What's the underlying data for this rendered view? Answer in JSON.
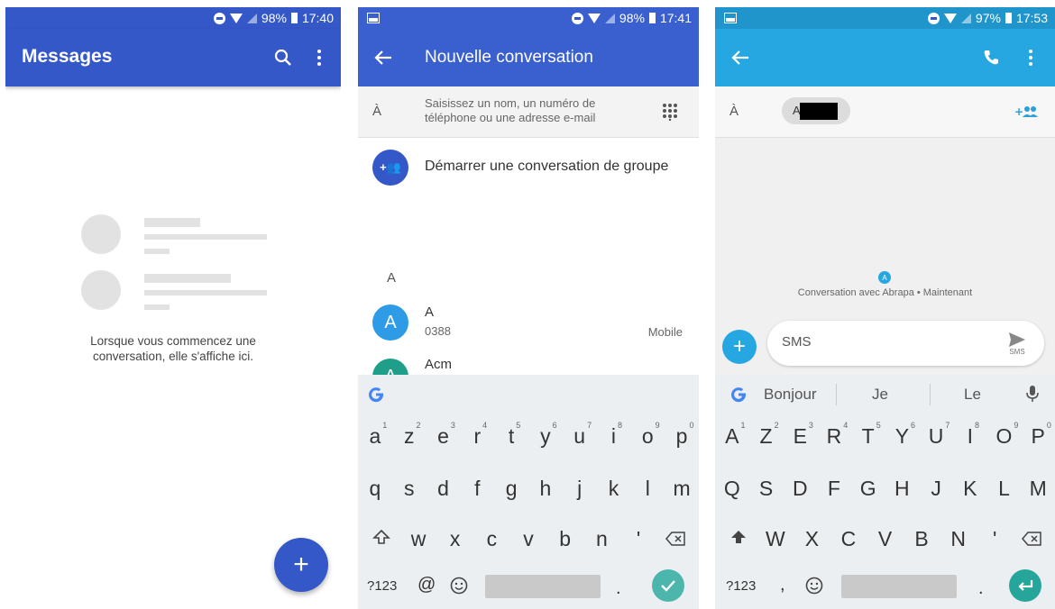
{
  "screen1": {
    "status": {
      "battery": "98%",
      "time": "17:40"
    },
    "title": "Messages",
    "empty_text_line1": "Lorsque vous commencez une",
    "empty_text_line2": "conversation, elle s'affiche ici.",
    "fab_icon": "+",
    "colors": {
      "appbar": "#3558C8",
      "fab": "#3558C8"
    }
  },
  "screen2": {
    "status": {
      "battery": "98%",
      "time": "17:41"
    },
    "title": "Nouvelle conversation",
    "to_label": "À",
    "to_placeholder_line1": "Saisissez un nom, un numéro de",
    "to_placeholder_line2": "téléphone ou une adresse e-mail",
    "group_label": "Démarrer une conversation de groupe",
    "group_icon": "+👥",
    "section_letter": "A",
    "contacts": [
      {
        "initial": "A",
        "name": "A",
        "number": "0388",
        "type": "Mobile",
        "color": "#2e9be6"
      },
      {
        "initial": "A",
        "name": "Acm",
        "number": "",
        "type": "",
        "color": "#1f9e89"
      }
    ],
    "keyboard": {
      "row1": [
        "a",
        "z",
        "e",
        "r",
        "t",
        "y",
        "u",
        "i",
        "o",
        "p"
      ],
      "row1_sup": [
        "1",
        "2",
        "3",
        "4",
        "5",
        "6",
        "7",
        "8",
        "9",
        "0"
      ],
      "row2": [
        "q",
        "s",
        "d",
        "f",
        "g",
        "h",
        "j",
        "k",
        "l",
        "m"
      ],
      "row3": [
        "w",
        "x",
        "c",
        "v",
        "b",
        "n",
        "'"
      ],
      "num_label": "?123",
      "at": "@"
    }
  },
  "screen3": {
    "status": {
      "battery": "97%",
      "time": "17:53"
    },
    "to_label": "À",
    "chip_initial": "A",
    "conversation_info": "Conversation avec Abrapa • Maintenant",
    "message_placeholder": "SMS",
    "send_label": "SMS",
    "suggestions": [
      "Bonjour",
      "Je",
      "Le"
    ],
    "keyboard": {
      "row1": [
        "A",
        "Z",
        "E",
        "R",
        "T",
        "Y",
        "U",
        "I",
        "O",
        "P"
      ],
      "row1_sup": [
        "1",
        "2",
        "3",
        "4",
        "5",
        "6",
        "7",
        "8",
        "9",
        "0"
      ],
      "row2": [
        "Q",
        "S",
        "D",
        "F",
        "G",
        "H",
        "J",
        "K",
        "L",
        "M"
      ],
      "row3": [
        "W",
        "X",
        "C",
        "V",
        "B",
        "N",
        "'"
      ],
      "num_label": "?123",
      "comma": ","
    },
    "colors": {
      "appbar": "#27a7e2",
      "status": "#1f95cc",
      "enter": "#26a69a"
    }
  }
}
